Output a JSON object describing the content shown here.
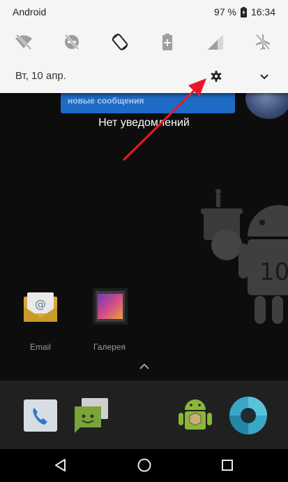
{
  "status_bar": {
    "carrier": "Android",
    "battery_percent": "97 %",
    "time": "16:34"
  },
  "quick_settings": {
    "tiles": [
      {
        "icon": "wifi-off-icon"
      },
      {
        "icon": "do-not-disturb-off-icon"
      },
      {
        "icon": "auto-rotate-icon"
      },
      {
        "icon": "battery-saver-icon"
      },
      {
        "icon": "cellular-signal-icon"
      },
      {
        "icon": "airplane-mode-icon"
      }
    ],
    "date": "Вт, 10 апр."
  },
  "background": {
    "message_peek": "новые сообщения",
    "no_notifications": "Нет уведомлений",
    "easter_egg_number": "10"
  },
  "home_apps": [
    {
      "label": "Email"
    },
    {
      "label": "Галерея"
    }
  ],
  "dock": {
    "apps": [
      {
        "icon": "phone-icon"
      },
      {
        "icon": "messages-icon"
      },
      {
        "icon": "android-market-icon"
      },
      {
        "icon": "camera-icon"
      }
    ]
  },
  "navigation": {
    "buttons": [
      "back-icon",
      "home-icon",
      "recents-icon"
    ]
  },
  "colors": {
    "shade_bg": "#f5f5f5",
    "icon_grey": "#9e9e9e",
    "annotation_arrow": "#e8182a",
    "message_blue": "#1e6bc6",
    "dock_bg": "#202020"
  }
}
